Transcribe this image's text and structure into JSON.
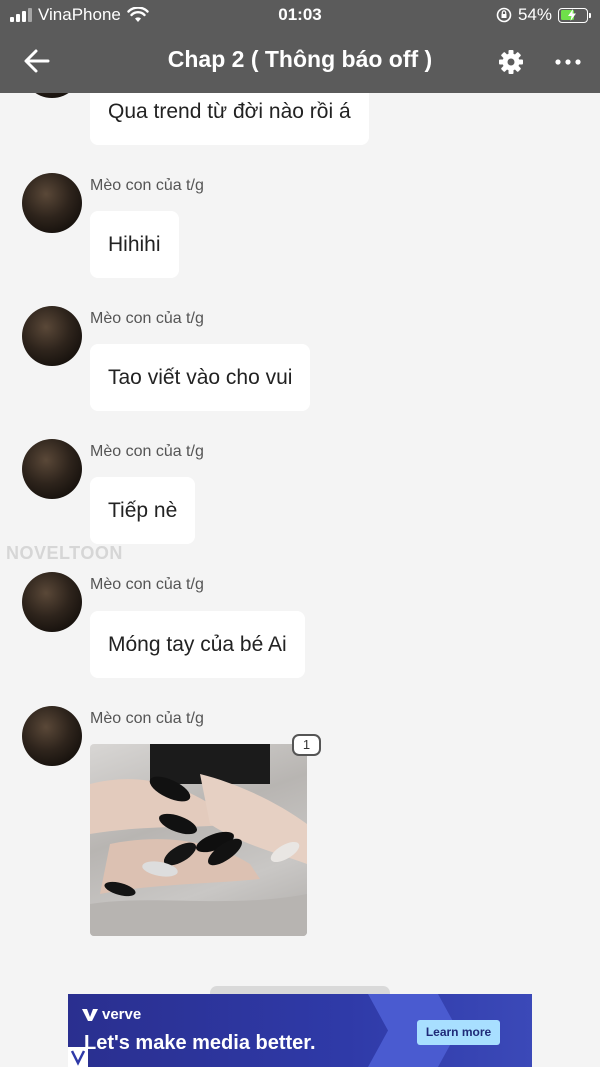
{
  "status_bar": {
    "carrier": "VinaPhone",
    "time": "01:03",
    "battery": "54%",
    "battery_level": 0.54
  },
  "nav": {
    "title": "Chap 2 ( Thông báo off )"
  },
  "watermark": "NOVELTOON",
  "messages": [
    {
      "sender": "",
      "text": "Qua trend từ đời nào rồi á"
    },
    {
      "sender": "Mèo con của t/g",
      "text": "Hihihi"
    },
    {
      "sender": "Mèo con của t/g",
      "text": "Tao viết vào cho vui"
    },
    {
      "sender": "Mèo con của t/g",
      "text": "Tiếp nè"
    },
    {
      "sender": "Mèo con của t/g",
      "text": "Móng tay của bé Ai"
    },
    {
      "sender": "Mèo con của t/g",
      "image_count": "1"
    }
  ],
  "ad": {
    "brand": "verve",
    "headline": "Let's make media better.",
    "cta": "Learn more"
  },
  "colors": {
    "header_bg": "#5b5b5b",
    "chat_bg": "#f4f4f4",
    "bubble_bg": "#ffffff",
    "ad_bg": "#2f3aa8",
    "ad_cta_bg": "#a8dfff"
  }
}
